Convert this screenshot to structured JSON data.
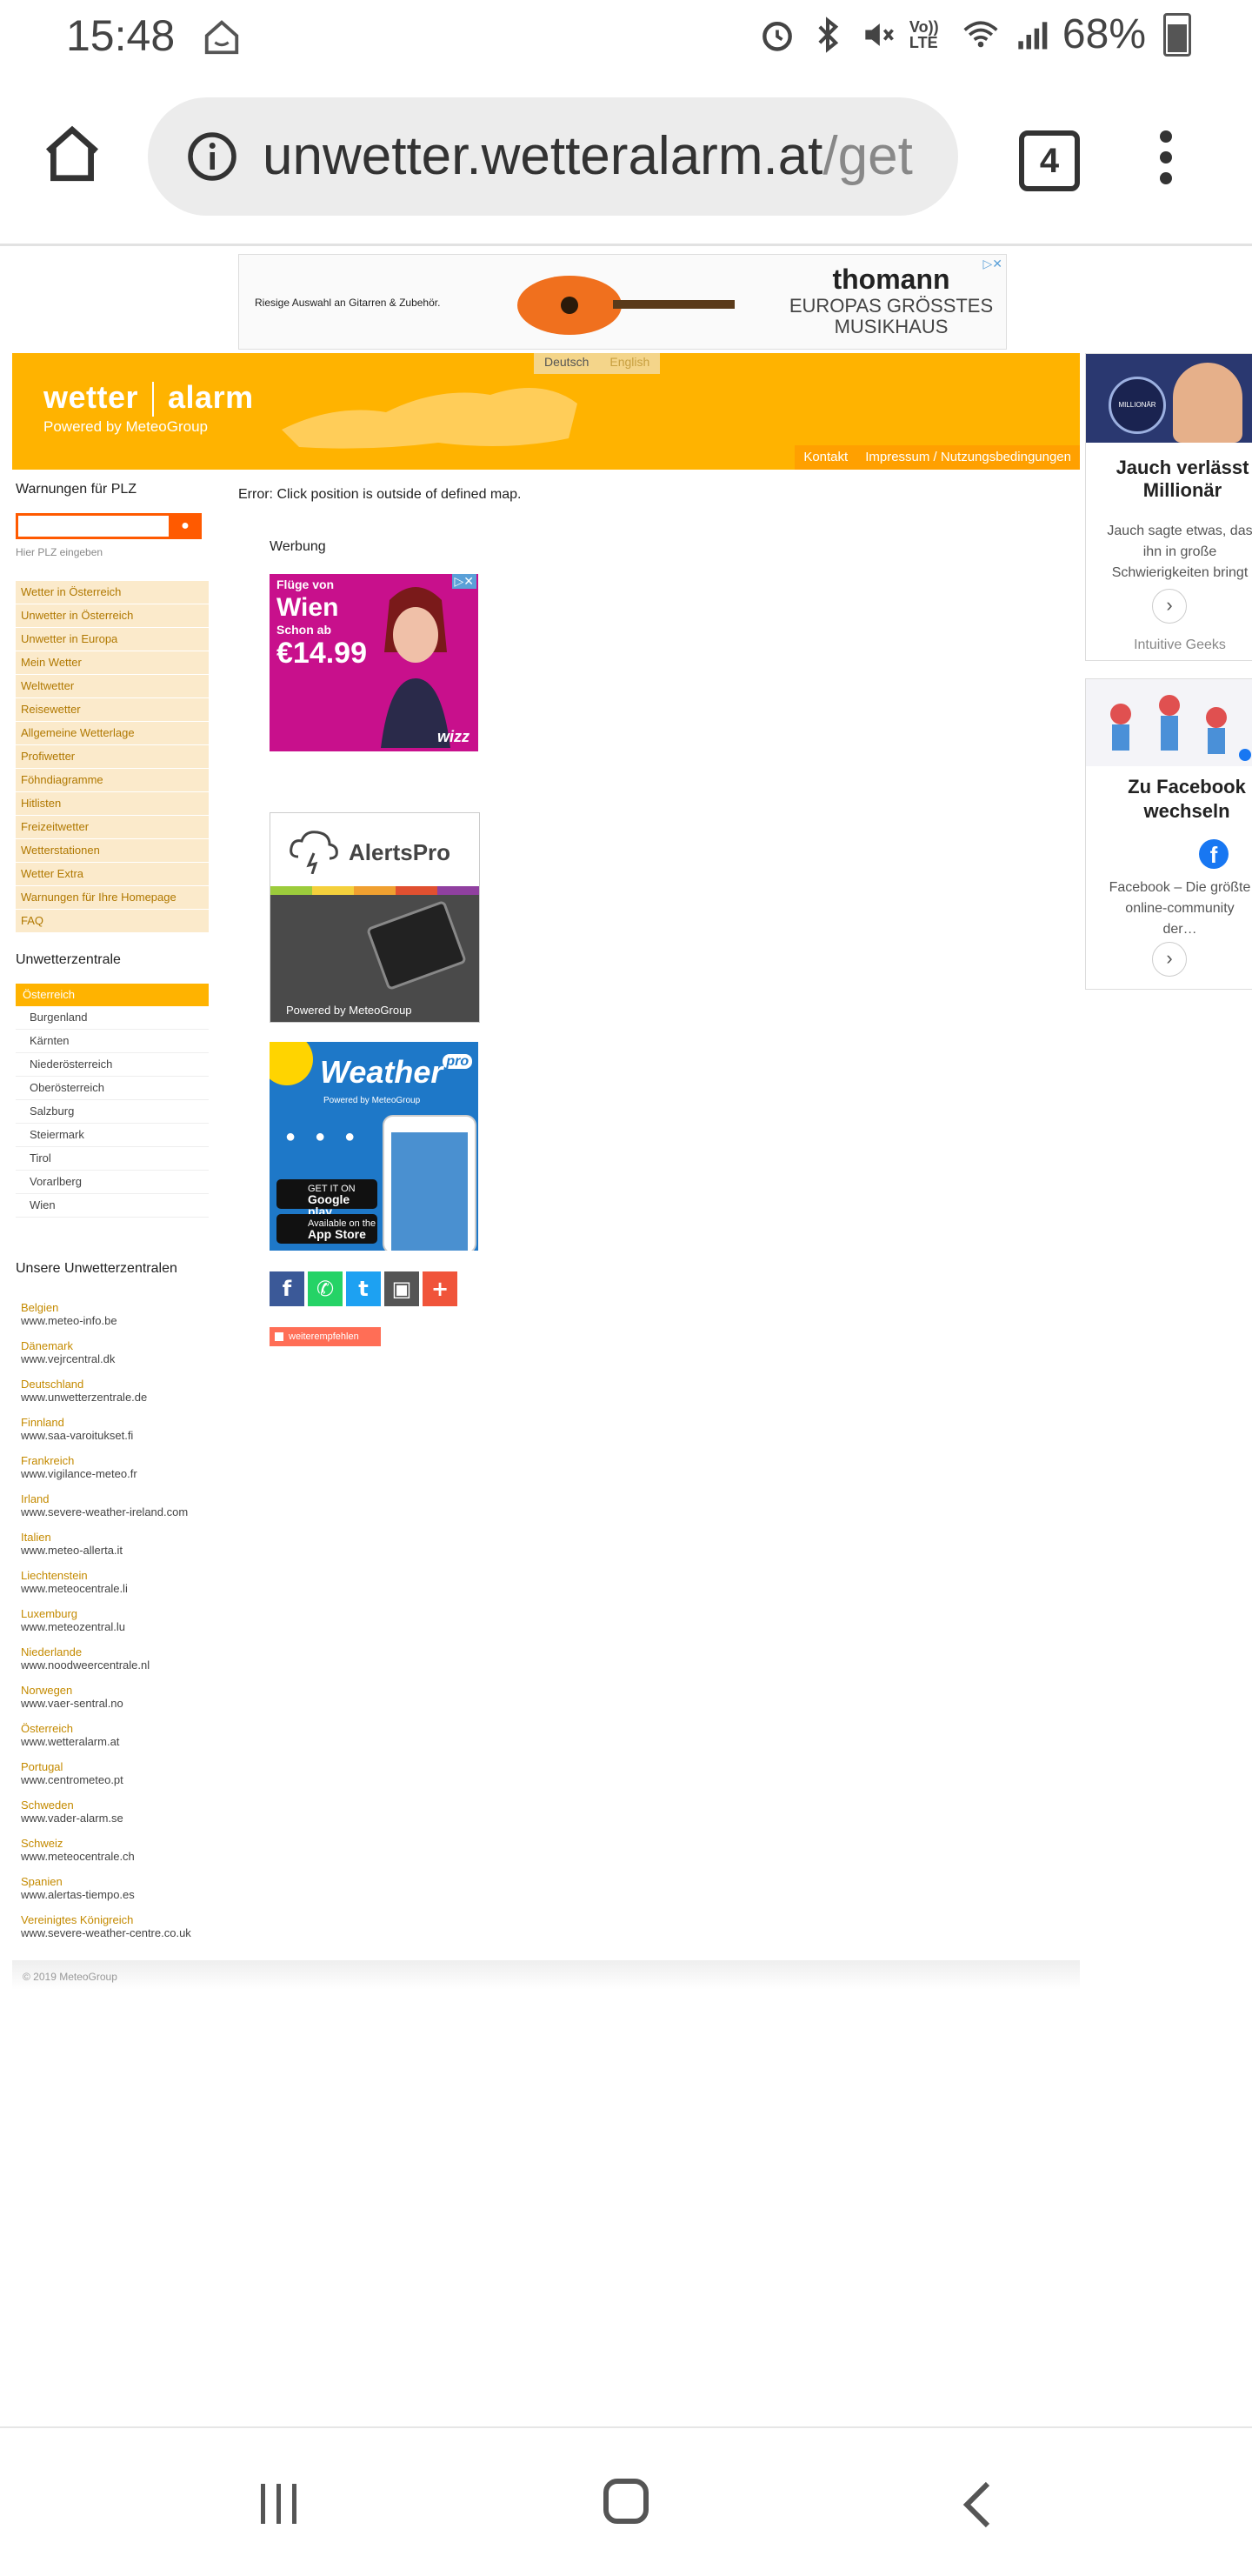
{
  "status_bar": {
    "time": "15:48",
    "volte": "Vo)) LTE",
    "battery": "68%",
    "icons": [
      "home-assistant-icon",
      "alarm-icon",
      "bluetooth-icon",
      "mute-icon",
      "volte-icon",
      "wifi-icon",
      "signal-icon",
      "battery-icon"
    ]
  },
  "browser": {
    "url_main": "unwetter.wetteralarm.at",
    "url_rest": "/get",
    "tab_count": "4"
  },
  "top_ad": {
    "small_text": "Riesige Auswahl an Gitarren & Zubehör.",
    "brand": "thomann",
    "tagline1": "EUROPAS GRÖSSTES",
    "tagline2": "MUSIKHAUS"
  },
  "header": {
    "lang_de": "Deutsch",
    "lang_en": "English",
    "logo_left": "wetter",
    "logo_right": "alarm",
    "logo_sub": "Powered by MeteoGroup",
    "link_kontakt": "Kontakt",
    "link_impressum": "Impressum / Nutzungsbedingungen",
    "accent": "#ffb300"
  },
  "sidebar": {
    "plz_title": "Warnungen für PLZ",
    "plz_placeholder": "",
    "plz_hint": "Hier PLZ eingeben",
    "nav": [
      "Wetter in Österreich",
      "Unwetter in Österreich",
      "Unwetter in Europa",
      "Mein Wetter",
      "Weltwetter",
      "Reisewetter",
      "Allgemeine Wetterlage",
      "Profiwetter",
      "Föhndiagramme",
      "Hitlisten",
      "Freizeitwetter",
      "Wetterstationen",
      "Wetter Extra",
      "Warnungen für Ihre Homepage",
      "FAQ"
    ],
    "uz_title": "Unwetterzentrale",
    "region_head": "Österreich",
    "regions": [
      "Burgenland",
      "Kärnten",
      "Niederösterreich",
      "Oberösterreich",
      "Salzburg",
      "Steiermark",
      "Tirol",
      "Vorarlberg",
      "Wien"
    ],
    "uu_title": "Unsere Unwetterzentralen",
    "countries": [
      {
        "name": "Belgien",
        "url": "www.meteo-info.be"
      },
      {
        "name": "Dänemark",
        "url": "www.vejrcentral.dk"
      },
      {
        "name": "Deutschland",
        "url": "www.unwetterzentrale.de"
      },
      {
        "name": "Finnland",
        "url": "www.saa-varoitukset.fi"
      },
      {
        "name": "Frankreich",
        "url": "www.vigilance-meteo.fr"
      },
      {
        "name": "Irland",
        "url": "www.severe-weather-ireland.com"
      },
      {
        "name": "Italien",
        "url": "www.meteo-allerta.it"
      },
      {
        "name": "Liechtenstein",
        "url": "www.meteocentrale.li"
      },
      {
        "name": "Luxemburg",
        "url": "www.meteozentral.lu"
      },
      {
        "name": "Niederlande",
        "url": "www.noodweercentrale.nl"
      },
      {
        "name": "Norwegen",
        "url": "www.vaer-sentral.no"
      },
      {
        "name": "Österreich",
        "url": "www.wetteralarm.at"
      },
      {
        "name": "Portugal",
        "url": "www.centrometeo.pt"
      },
      {
        "name": "Schweden",
        "url": "www.vader-alarm.se"
      },
      {
        "name": "Schweiz",
        "url": "www.meteocentrale.ch"
      },
      {
        "name": "Spanien",
        "url": "www.alertas-tiempo.es"
      },
      {
        "name": "Vereinigtes Königreich",
        "url": "www.severe-weather-centre.co.uk"
      }
    ]
  },
  "main": {
    "error": "Error: Click position is outside of defined map.",
    "werbung": "Werbung",
    "wizz": {
      "t1": "Flüge von",
      "t2": "Wien",
      "t3": "Schon ab",
      "t4": "€14.99",
      "logo": "wizz"
    },
    "alertspro": {
      "title": "AlertsPro",
      "powered": "Powered by MeteoGroup"
    },
    "weatherpro": {
      "title": "Weather",
      "pro": "pro",
      "sub": "Powered by MeteoGroup",
      "gp1": "GET IT ON",
      "gp2": "Google play",
      "as1": "Available on the",
      "as2": "App Store"
    },
    "share": [
      "f",
      "✆",
      "t",
      "▣",
      "+"
    ],
    "recommend": "weiterempfehlen"
  },
  "footer": {
    "text": "© 2019 MeteoGroup"
  },
  "right_ads": {
    "ad1": {
      "title": "Jauch verlässt Millionär",
      "desc": "Jauch sagte etwas, das ihn in große Schwierigkeiten bringt",
      "source": "Intuitive Geeks",
      "logo": "MILLIONÄR"
    },
    "ad2": {
      "title": "Zu Facebook wechseln",
      "desc": "Facebook – Die größte online-community der…",
      "fb": "f"
    }
  }
}
